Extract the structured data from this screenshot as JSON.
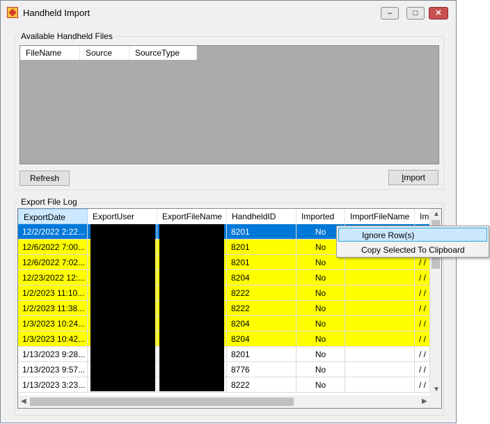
{
  "window": {
    "title": "Handheld Import",
    "controls": {
      "minimize": "–",
      "maximize": "□",
      "close": "✕"
    }
  },
  "available_files": {
    "group_label": "Available Handheld Files",
    "columns": [
      "FileName",
      "Source",
      "SourceType"
    ],
    "refresh_label": "Refresh",
    "import_label": "Import",
    "import_accel": "I",
    "import_rest": "mport"
  },
  "export_log": {
    "group_label": "Export File Log",
    "columns": [
      "ExportDate",
      "ExportUser",
      "ExportFileName",
      "HandheldID",
      "Imported",
      "ImportFileName",
      "Im"
    ],
    "rows": [
      {
        "export_date": "12/2/2022 2:22...",
        "handheld_id": "8201",
        "imported": "No",
        "im": "/ /",
        "state": "selected"
      },
      {
        "export_date": "12/6/2022 7:00...",
        "handheld_id": "8201",
        "imported": "No",
        "im": "/ /",
        "state": "highlight"
      },
      {
        "export_date": "12/6/2022 7:02...",
        "handheld_id": "8201",
        "imported": "No",
        "im": "/ /",
        "state": "highlight"
      },
      {
        "export_date": "12/23/2022 12:...",
        "handheld_id": "8204",
        "imported": "No",
        "im": "/ /",
        "state": "highlight"
      },
      {
        "export_date": "1/2/2023 11:10...",
        "handheld_id": "8222",
        "imported": "No",
        "im": "/ /",
        "state": "highlight"
      },
      {
        "export_date": "1/2/2023 11:38...",
        "handheld_id": "8222",
        "imported": "No",
        "im": "/ /",
        "state": "highlight"
      },
      {
        "export_date": "1/3/2023 10:24...",
        "handheld_id": "8204",
        "imported": "No",
        "im": "/ /",
        "state": "highlight"
      },
      {
        "export_date": "1/3/2023 10:42...",
        "handheld_id": "8204",
        "imported": "No",
        "im": "/ /",
        "state": "highlight"
      },
      {
        "export_date": "1/13/2023 9:28...",
        "handheld_id": "8201",
        "imported": "No",
        "im": "/ /",
        "state": "normal"
      },
      {
        "export_date": "1/13/2023 9:57...",
        "handheld_id": "8776",
        "imported": "No",
        "im": "/ /",
        "state": "normal"
      },
      {
        "export_date": "1/13/2023 3:23...",
        "handheld_id": "8222",
        "imported": "No",
        "im": "/ /",
        "state": "normal"
      }
    ]
  },
  "context_menu": {
    "items": [
      "Ignore Row(s)",
      "Copy Selected To Clipboard"
    ]
  },
  "colors": {
    "selected": "#0078d7",
    "highlight": "#ffff00",
    "redaction": "#000000"
  }
}
